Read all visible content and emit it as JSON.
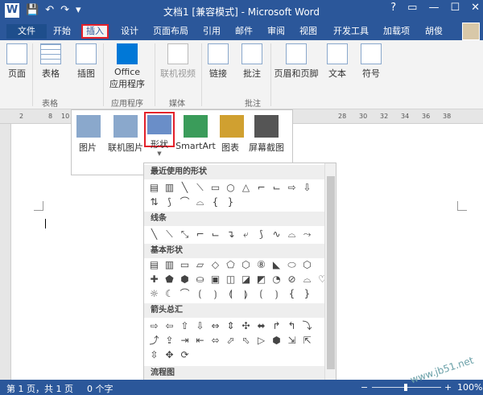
{
  "window": {
    "title": "文档1 [兼容模式] - Microsoft Word",
    "controls": [
      "?",
      "▭",
      "—",
      "☐",
      "✕"
    ]
  },
  "quick_access": [
    "W",
    "💾",
    "↶",
    "↷",
    "▾"
  ],
  "tabs": [
    "文件",
    "开始",
    "插入",
    "设计",
    "页面布局",
    "引用",
    "邮件",
    "审阅",
    "视图",
    "开发工具",
    "加载项",
    "胡俊"
  ],
  "ribbon": {
    "buttons": [
      "页面",
      "表格",
      "插图",
      "Office\n应用程序",
      "联机视频",
      "链接",
      "批注",
      "页眉和页脚",
      "文本",
      "符号"
    ],
    "groups": [
      "表格",
      "应用程序",
      "媒体",
      "批注"
    ]
  },
  "illustrations": {
    "buttons": [
      "图片",
      "联机图片",
      "形状",
      "SmartArt",
      "图表",
      "屏幕截图"
    ]
  },
  "shapes": {
    "sections": [
      "最近使用的形状",
      "线条",
      "基本形状",
      "箭头总汇",
      "流程图"
    ],
    "rows": [
      [
        "▤",
        "▥",
        "╲",
        "⟍",
        "▭",
        "○",
        "△",
        "⌐",
        "⌙",
        "⇨",
        "⇩"
      ],
      [
        "⇅",
        "⟆",
        "⌒",
        "⌓",
        "{",
        "}"
      ],
      [
        "╲",
        "⟍",
        "⤡",
        "⌐",
        "⌙",
        "↴",
        "⤶",
        "⟆",
        "∿",
        "⌓",
        "⤳"
      ],
      [
        "▤",
        "▥",
        "▭",
        "▱",
        "◇",
        "⬠",
        "⬡",
        "⑧",
        "◣",
        "⬭",
        "⬡"
      ],
      [
        "✚",
        "⬟",
        "⬢",
        "⛀",
        "▣",
        "◫",
        "◪",
        "◩",
        "◔",
        "⊘",
        "⌓",
        "♡",
        "⟋"
      ],
      [
        "☼",
        "☾",
        "⌒",
        "⟮",
        "⟯",
        "⟬",
        "⟭",
        "⟮",
        "⟯",
        "{",
        "}"
      ],
      [
        "⇨",
        "⇦",
        "⇧",
        "⇩",
        "⇔",
        "⇕",
        "✣",
        "⬌",
        "↱",
        "↰",
        "⤵"
      ],
      [
        "⤴",
        "⇪",
        "⇥",
        "⇤",
        "⬄",
        "⬀",
        "⬁",
        "▷",
        "⬢",
        "⇲",
        "⇱"
      ],
      [
        "⇳",
        "✥",
        "⟳"
      ],
      [
        "▭",
        "▢",
        "◇",
        "▱",
        "▭",
        "▭",
        "▭",
        "▭",
        "▭",
        "○",
        "⬭"
      ]
    ]
  },
  "ruler_marks": [
    "2",
    "8",
    "10",
    "28",
    "30",
    "32",
    "34",
    "36",
    "38"
  ],
  "status": {
    "page": "第 1 页，共 1 页",
    "words": "0 个字",
    "zoom": "100%",
    "minus": "−",
    "plus": "+"
  },
  "watermark": "www.jb51.net"
}
